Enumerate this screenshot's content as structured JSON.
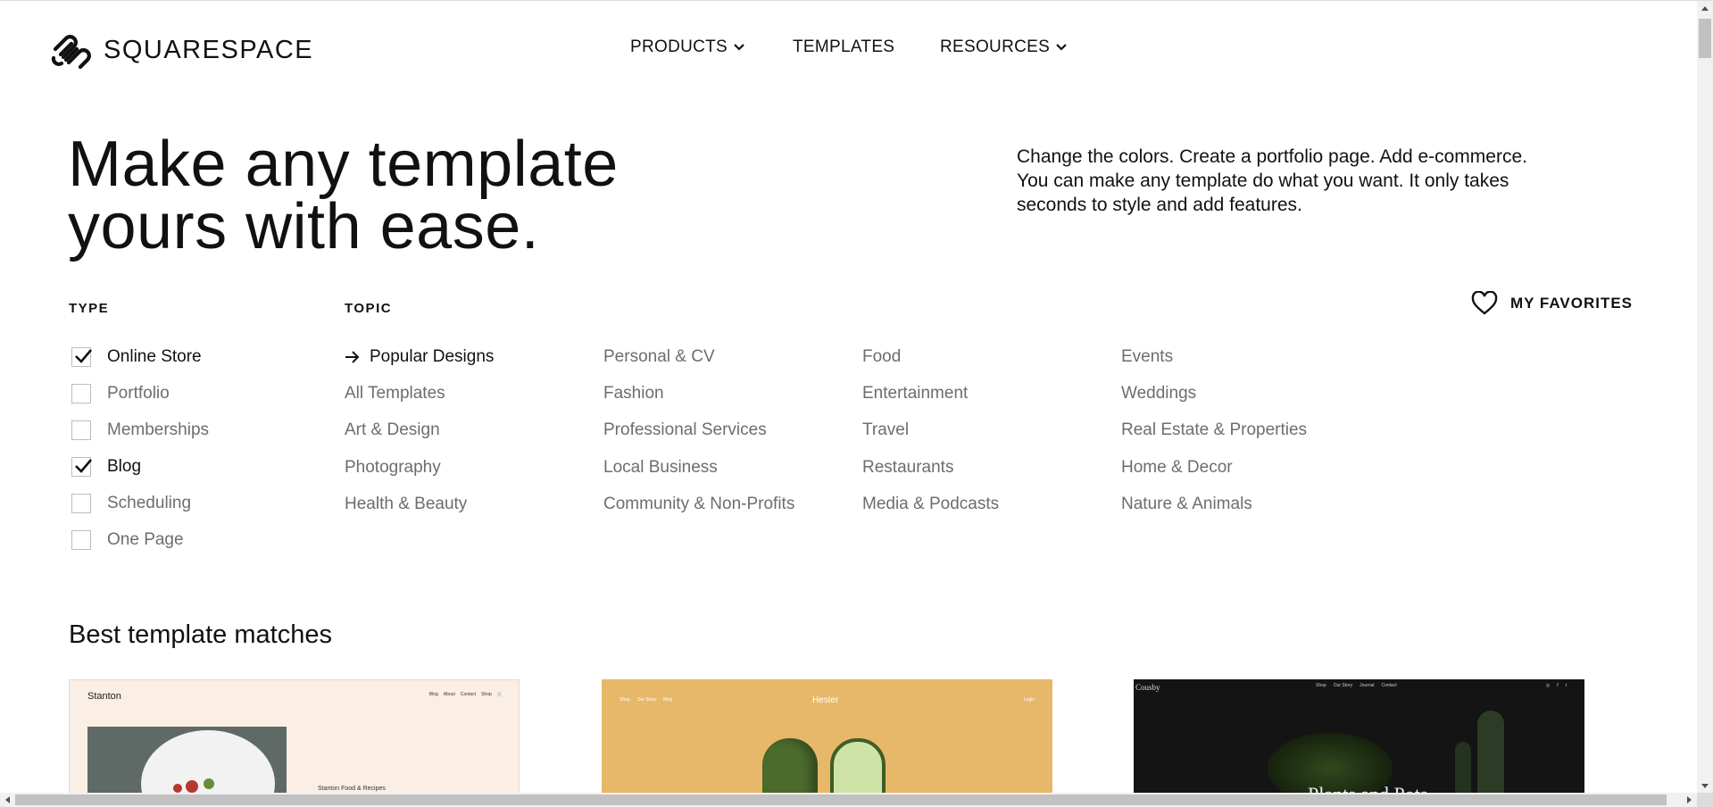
{
  "header": {
    "logo_text": "SQUARESPACE",
    "nav": [
      {
        "label": "PRODUCTS",
        "has_dropdown": true
      },
      {
        "label": "TEMPLATES",
        "has_dropdown": false
      },
      {
        "label": "RESOURCES",
        "has_dropdown": true
      }
    ]
  },
  "hero": {
    "title_line1": "Make any template",
    "title_line2": "yours with ease.",
    "description_line1": "Change the colors. Create a portfolio page. Add e-commerce.",
    "description_line2": "You can make any template do what you want. It only takes",
    "description_line3": "seconds to style and add features."
  },
  "filters": {
    "type_label": "TYPE",
    "topic_label": "TOPIC",
    "types": [
      {
        "label": "Online Store",
        "checked": true
      },
      {
        "label": "Portfolio",
        "checked": false
      },
      {
        "label": "Memberships",
        "checked": false
      },
      {
        "label": "Blog",
        "checked": true
      },
      {
        "label": "Scheduling",
        "checked": false
      },
      {
        "label": "One Page",
        "checked": false
      }
    ],
    "topics": {
      "col1": [
        "Popular Designs",
        "All Templates",
        "Art & Design",
        "Photography",
        "Health & Beauty"
      ],
      "col2": [
        "Personal & CV",
        "Fashion",
        "Professional Services",
        "Local Business",
        "Community & Non-Profits"
      ],
      "col3": [
        "Food",
        "Entertainment",
        "Travel",
        "Restaurants",
        "Media & Podcasts"
      ],
      "col4": [
        "Events",
        "Weddings",
        "Real Estate & Properties",
        "Home & Decor",
        "Nature & Animals"
      ]
    },
    "active_topic": "Popular Designs",
    "favorites_label": "MY FAVORITES"
  },
  "results": {
    "section_title": "Best template matches",
    "cards": [
      {
        "name": "Stanton",
        "nav": [
          "Blog",
          "About",
          "Contact",
          "Shop"
        ],
        "caption": "Stanton Food & Recipes"
      },
      {
        "name": "Hester",
        "nav_left": [
          "Shop",
          "Our Story",
          "Blog"
        ],
        "nav_right": "Login"
      },
      {
        "name": "Cousby",
        "nav": [
          "Shop",
          "Our Story",
          "Journal",
          "Contact"
        ],
        "title": "Plants and Pots"
      }
    ]
  },
  "colors": {
    "text": "#111111",
    "muted": "#6d6d6d",
    "stanton_bg": "#fbeee5",
    "hester_bg": "#e8b86a",
    "cousby_bg": "#141414"
  }
}
